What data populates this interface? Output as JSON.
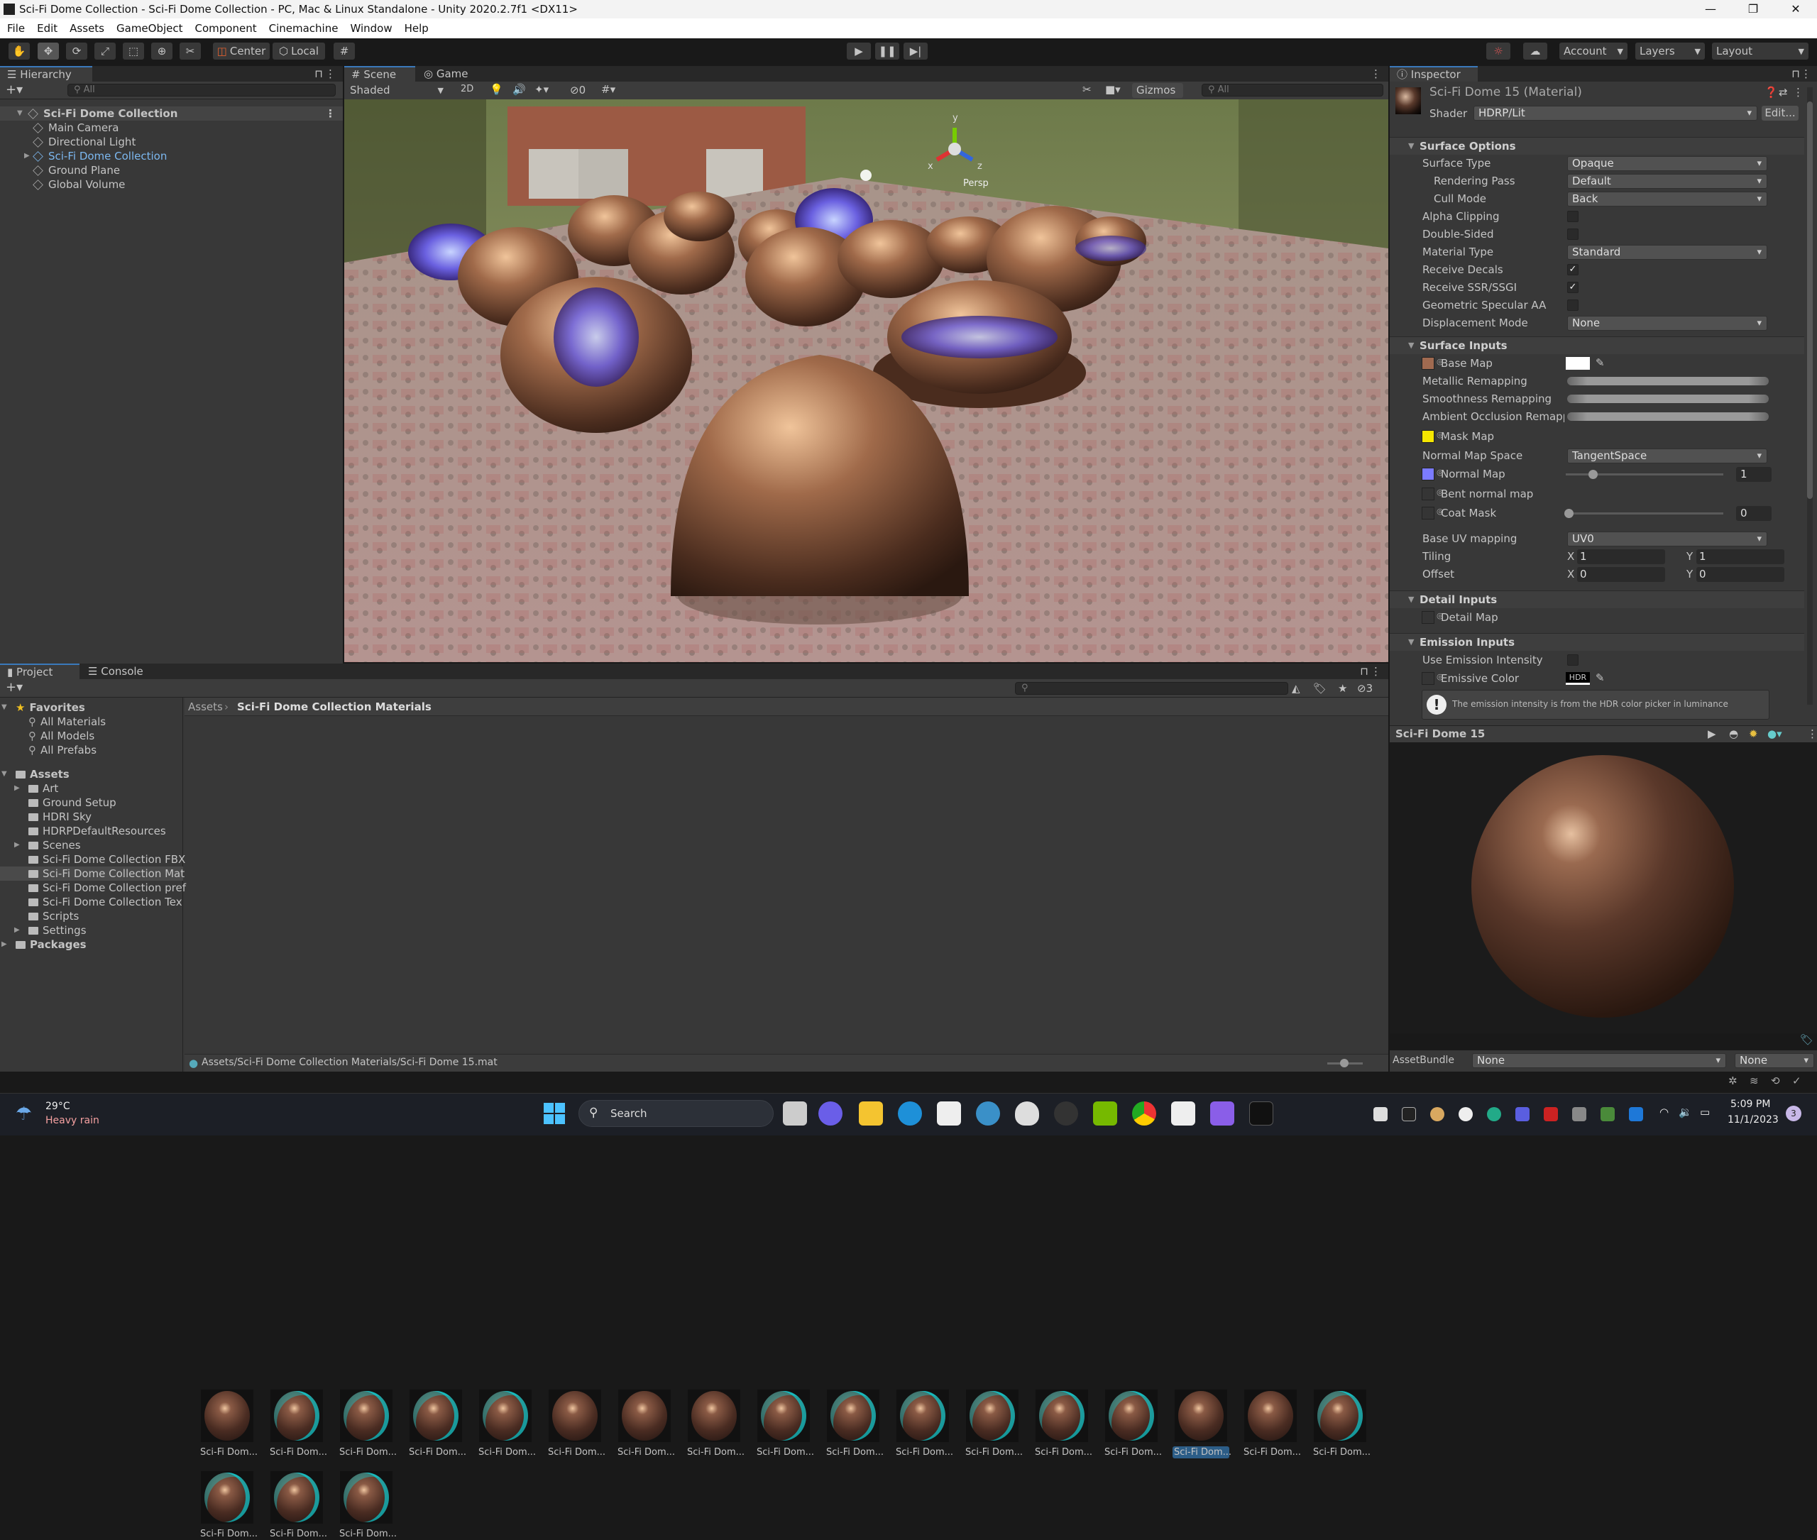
{
  "window": {
    "title": "Sci-Fi Dome Collection - Sci-Fi Dome Collection - PC, Mac & Linux Standalone - Unity 2020.2.7f1 <DX11>",
    "minimize": "—",
    "maximize": "❐",
    "close": "✕"
  },
  "menu": [
    "File",
    "Edit",
    "Assets",
    "GameObject",
    "Component",
    "Cinemachine",
    "Window",
    "Help"
  ],
  "toolbar": {
    "pivot": "Center",
    "space": "Local",
    "account": "Account",
    "layers": "Layers",
    "layout": "Layout"
  },
  "hierarchy": {
    "tab": "Hierarchy",
    "search_placeholder": "All",
    "items": [
      {
        "label": "Sci-Fi Dome Collection",
        "root": true
      },
      {
        "label": "Main Camera"
      },
      {
        "label": "Directional Light"
      },
      {
        "label": "Sci-Fi Dome Collection",
        "prefab": true
      },
      {
        "label": "Ground Plane"
      },
      {
        "label": "Global Volume"
      }
    ]
  },
  "scene": {
    "tabs": [
      "Scene",
      "Game"
    ],
    "shading": "Shaded",
    "mode_2d": "2D",
    "hidden_count": "0",
    "gizmos": "Gizmos",
    "search_placeholder": "All",
    "axis_y": "y",
    "axis_x": "x",
    "axis_z": "z",
    "persp": "Persp"
  },
  "inspector": {
    "tab": "Inspector",
    "title": "Sci-Fi Dome 15 (Material)",
    "shader_label": "Shader",
    "shader": "HDRP/Lit",
    "edit": "Edit...",
    "sections": {
      "surface_options": "Surface Options",
      "surface_inputs": "Surface Inputs",
      "detail_inputs": "Detail Inputs",
      "emission_inputs": "Emission Inputs"
    },
    "surface_options": [
      {
        "label": "Surface Type",
        "value": "Opaque"
      },
      {
        "label": "Rendering Pass",
        "value": "Default"
      },
      {
        "label": "Cull Mode",
        "value": "Back"
      },
      {
        "label": "Alpha Clipping",
        "checked": false
      },
      {
        "label": "Double-Sided",
        "checked": false
      },
      {
        "label": "Material Type",
        "value": "Standard"
      },
      {
        "label": "Receive Decals",
        "checked": true
      },
      {
        "label": "Receive SSR/SSGI",
        "checked": true
      },
      {
        "label": "Geometric Specular AA",
        "checked": false
      },
      {
        "label": "Displacement Mode",
        "value": "None"
      }
    ],
    "surface_inputs": {
      "base_map": "Base Map",
      "base_color": "#ffffff",
      "metallic": "Metallic Remapping",
      "smoothness": "Smoothness Remapping",
      "ao": "Ambient Occlusion Remappi",
      "mask_map": "Mask Map",
      "mask_color": "#f5e600",
      "normal_space_label": "Normal Map Space",
      "normal_space": "TangentSpace",
      "normal_map": "Normal Map",
      "normal_color": "#7b7bff",
      "normal_strength": "1",
      "bent_normal": "Bent normal map",
      "coat_mask": "Coat Mask",
      "coat_value": "0",
      "uv_label": "Base UV mapping",
      "uv": "UV0",
      "tiling": "Tiling",
      "tiling_x": "1",
      "tiling_y": "1",
      "offset": "Offset",
      "offset_x": "0",
      "offset_y": "0",
      "x": "X",
      "y": "Y"
    },
    "detail_map": "Detail Map",
    "emission": {
      "use_intensity": "Use Emission Intensity",
      "emissive_color": "Emissive Color",
      "hdr": "HDR",
      "info": "The emission intensity is from the HDR color picker in luminance"
    },
    "preview_title": "Sci-Fi Dome 15",
    "assetbundle_label": "AssetBundle",
    "assetbundle": "None",
    "variant": "None"
  },
  "project": {
    "tabs": [
      "Project",
      "Console"
    ],
    "favorites": "Favorites",
    "favorite_items": [
      "All Materials",
      "All Models",
      "All Prefabs"
    ],
    "assets": "Assets",
    "folders": [
      {
        "label": "Art",
        "expandable": true
      },
      {
        "label": "Ground Setup"
      },
      {
        "label": "HDRI Sky"
      },
      {
        "label": "HDRPDefaultResources"
      },
      {
        "label": "Scenes",
        "expandable": true
      },
      {
        "label": "Sci-Fi Dome Collection FBX"
      },
      {
        "label": "Sci-Fi Dome Collection Mat",
        "selected": true
      },
      {
        "label": "Sci-Fi Dome Collection pref"
      },
      {
        "label": "Sci-Fi Dome Collection Tex"
      },
      {
        "label": "Scripts"
      },
      {
        "label": "Settings",
        "expandable": true
      }
    ],
    "packages": "Packages",
    "breadcrumb": [
      "Assets",
      "Sci-Fi Dome Collection Materials"
    ],
    "hidden_count": "3",
    "thumb_label": "Sci-Fi Dom...",
    "thumb_count": 20,
    "selected_index": 14,
    "status_path": "Assets/Sci-Fi Dome Collection Materials/Sci-Fi Dome 15.mat"
  },
  "taskbar": {
    "temp": "29°C",
    "weather": "Heavy rain",
    "search": "Search",
    "time": "5:09 PM",
    "date": "11/1/2023",
    "notifications": "3"
  }
}
